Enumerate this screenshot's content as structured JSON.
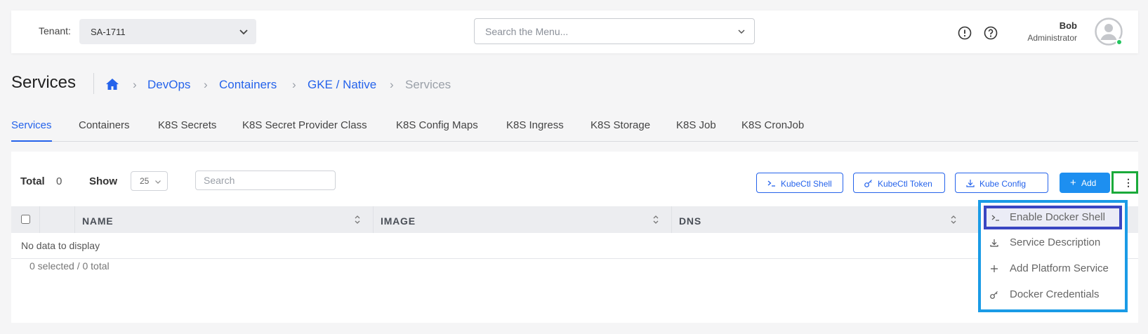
{
  "topbar": {
    "tenant_label": "Tenant:",
    "tenant_value": "SA-1711",
    "menu_search_placeholder": "Search the Menu...",
    "user_name": "Bob",
    "user_role": "Administrator"
  },
  "header": {
    "title": "Services",
    "breadcrumbs": [
      "DevOps",
      "Containers",
      "GKE / Native",
      "Services"
    ]
  },
  "tabs": [
    "Services",
    "Containers",
    "K8S Secrets",
    "K8S Secret Provider Class",
    "K8S Config Maps",
    "K8S Ingress",
    "K8S Storage",
    "K8S Job",
    "K8S CronJob"
  ],
  "toolbar": {
    "total_label": "Total",
    "total_value": "0",
    "show_label": "Show",
    "show_value": "25",
    "search_placeholder": "Search",
    "kubectl_shell": "KubeCtl Shell",
    "kubectl_token": "KubeCtl Token",
    "kube_config": "Kube Config",
    "add": "Add",
    "more": "⋮"
  },
  "table": {
    "columns": [
      "NAME",
      "IMAGE",
      "DNS"
    ],
    "empty_text": "No data to display",
    "footer": "0 selected / 0 total"
  },
  "dropdown": {
    "items": [
      {
        "label": "Enable Docker Shell",
        "icon": "terminal-icon"
      },
      {
        "label": "Service Description",
        "icon": "download-icon"
      },
      {
        "label": "Add Platform Service",
        "icon": "plus-icon"
      },
      {
        "label": "Docker Credentials",
        "icon": "key-icon"
      }
    ]
  },
  "colors": {
    "accent": "#2563eb",
    "add_button": "#1d8ff0",
    "more_highlight": "#1aaa3a",
    "dropdown_border": "#1a9be6",
    "selected_item_border": "#3a46c2",
    "online": "#22c55e"
  }
}
